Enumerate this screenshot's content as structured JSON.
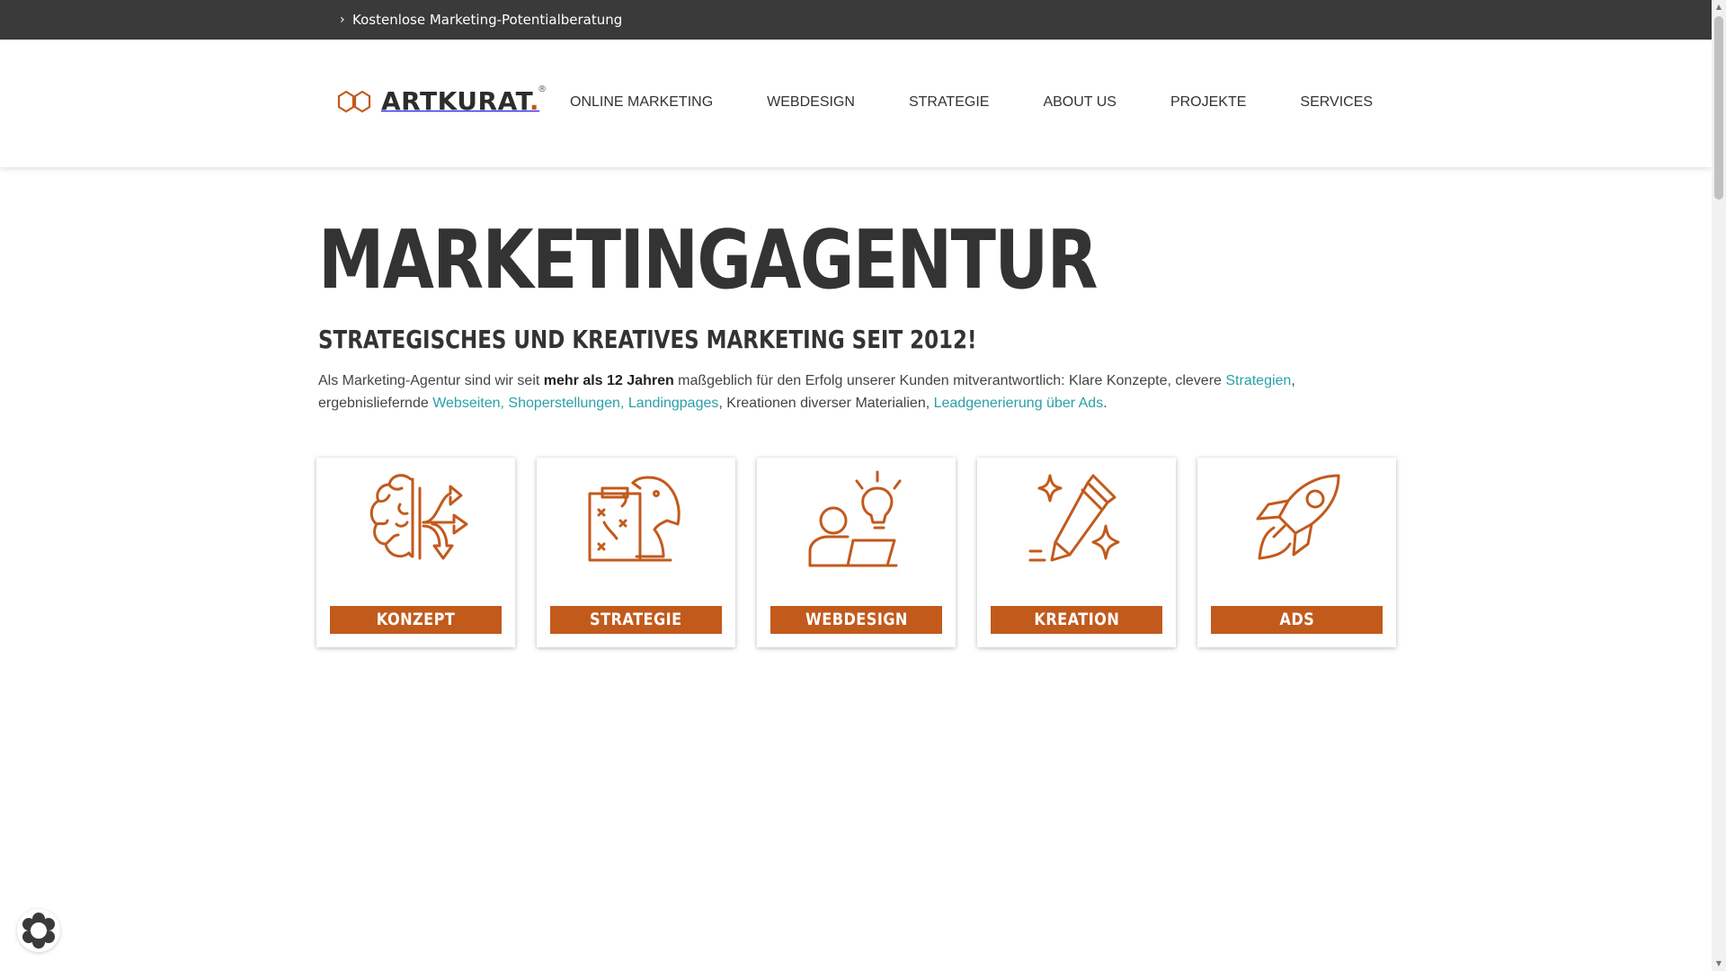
{
  "topbar": {
    "link_label": "Kostenlose Marketing-Potentialberatung",
    "chevron": "›"
  },
  "header": {
    "logo_text": "ARTKURAT",
    "logo_dot": ".",
    "logo_reg": "®",
    "nav": [
      {
        "label": "ONLINE MARKETING"
      },
      {
        "label": "WEBDESIGN"
      },
      {
        "label": "STRATEGIE"
      },
      {
        "label": "ABOUT US"
      },
      {
        "label": "PROJEKTE"
      },
      {
        "label": "SERVICES"
      }
    ]
  },
  "main": {
    "title": "MARKETINGAGENTUR",
    "subtitle": "STRATEGISCHES UND KREATIVES MARKETING SEIT 2012!",
    "intro": {
      "p1": "Als Marketing-Agentur sind wir seit ",
      "bold": "mehr als 12 Jahren",
      "p2": " maßgeblich für den Erfolg unserer Kunden mitverantwortlich: Klare Konzepte, clevere ",
      "link_strategien": "Strategien",
      "p3": ", ergebnisliefernde ",
      "link_web": "Webseiten, Shoperstellungen, Landingpages",
      "p4": ", Kreationen diverser Materialien, ",
      "link_ads": "Leadgenerierung über Ads",
      "p5": "."
    },
    "cards": [
      {
        "label": "KONZEPT",
        "icon": "brain-arrows-icon"
      },
      {
        "label": "STRATEGIE",
        "icon": "strategy-chess-icon"
      },
      {
        "label": "WEBDESIGN",
        "icon": "person-idea-laptop-icon"
      },
      {
        "label": "KREATION",
        "icon": "pencil-sparkle-icon"
      },
      {
        "label": "ADS",
        "icon": "rocket-icon"
      }
    ]
  },
  "colors": {
    "accent": "#c25a1c",
    "link": "#2aa0a8",
    "topbar": "#3a3a3a",
    "text": "#333333"
  }
}
